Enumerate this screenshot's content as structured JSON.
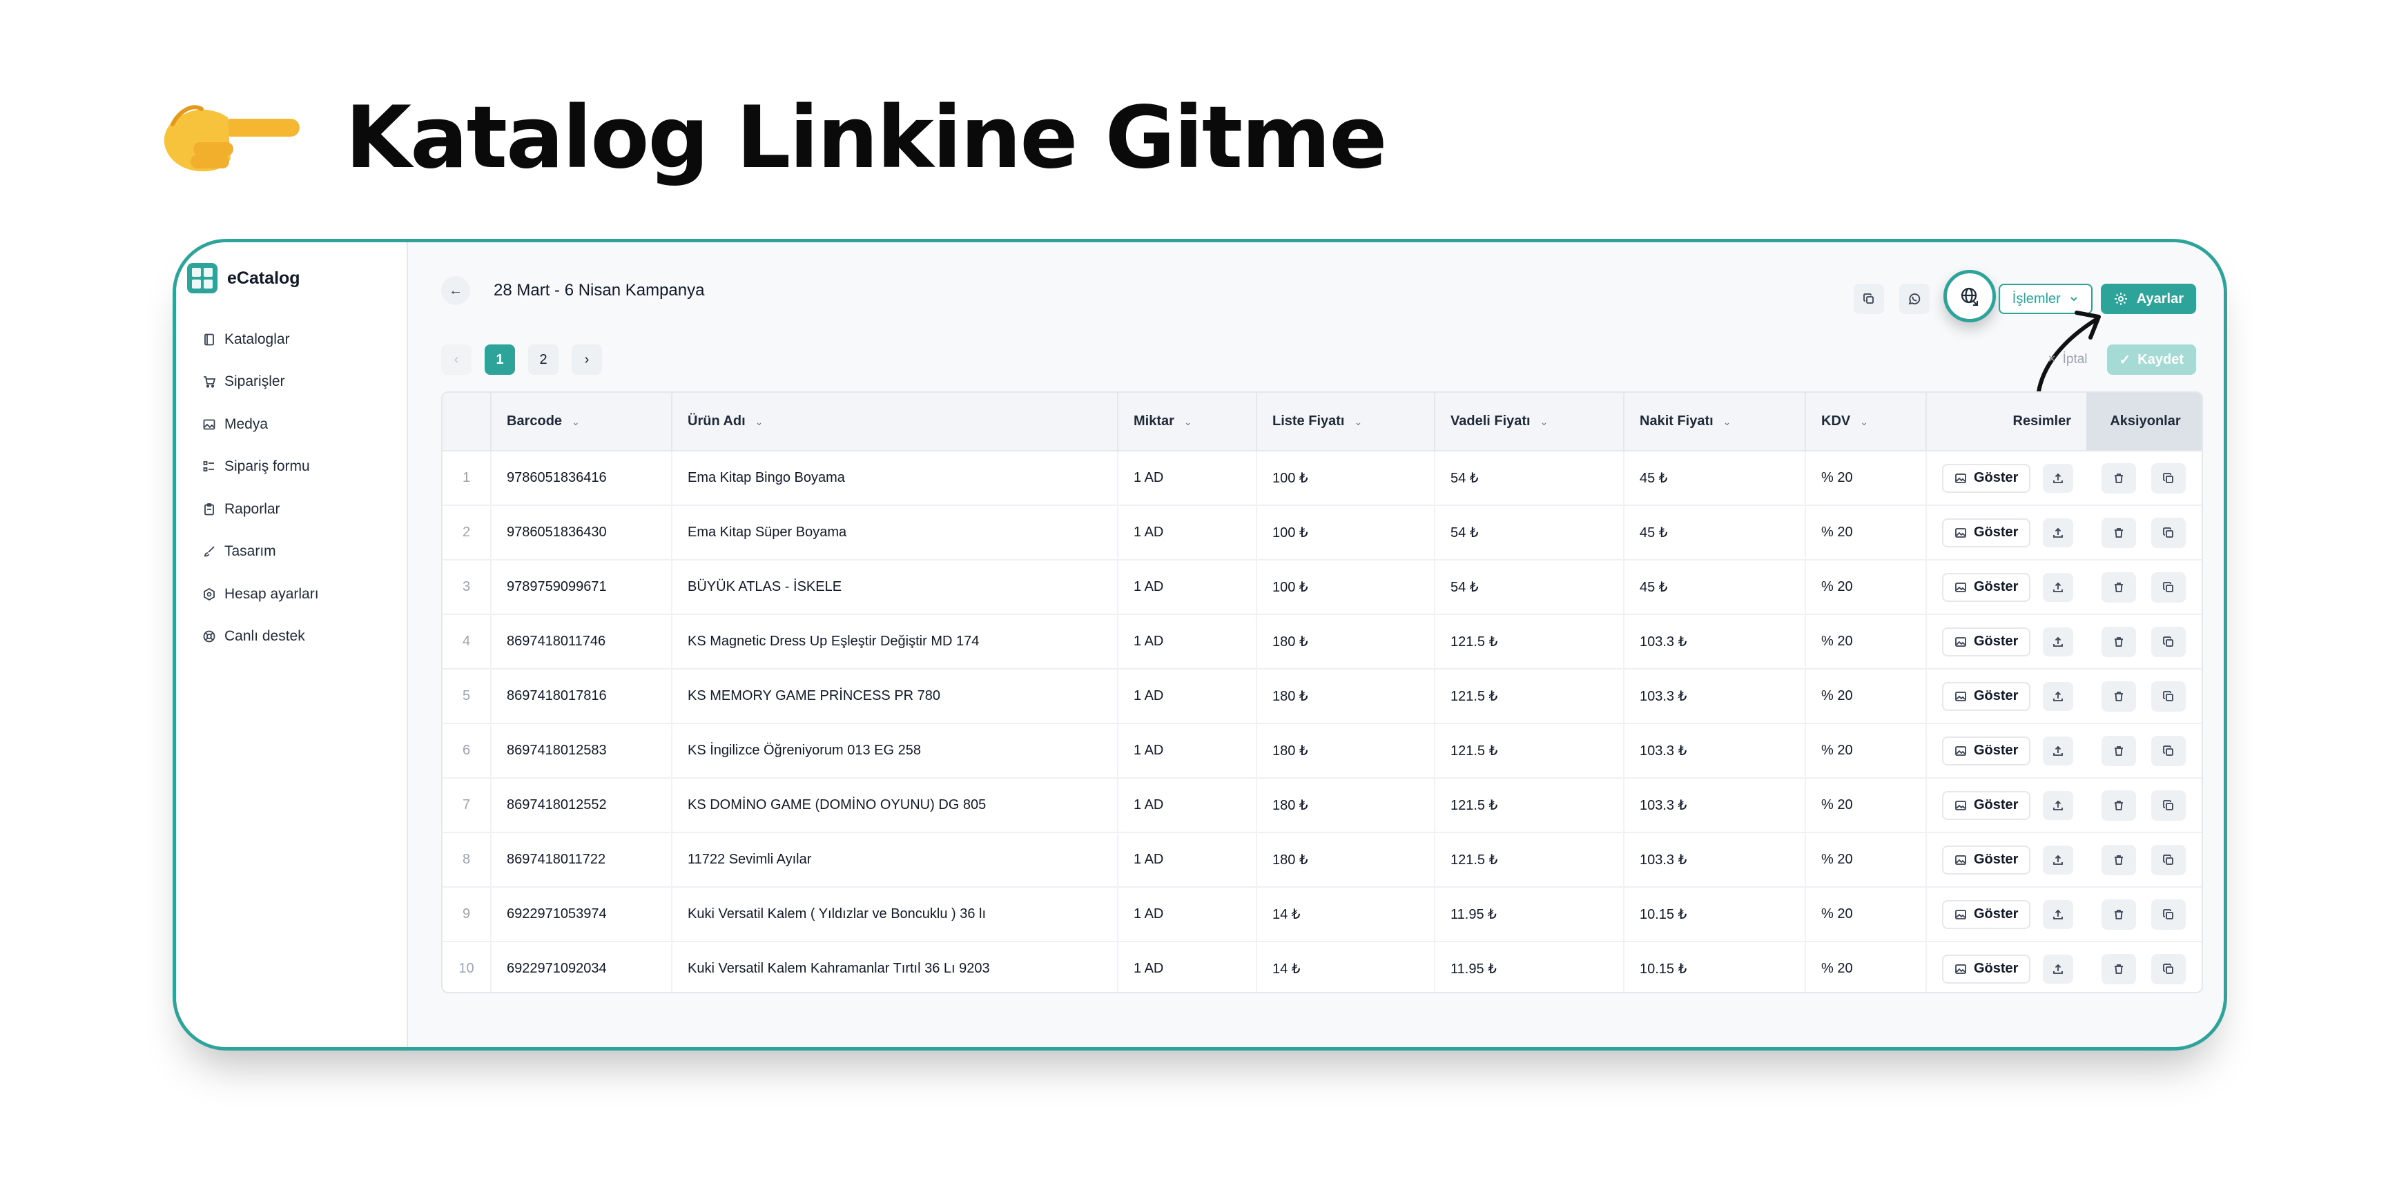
{
  "hero": {
    "title": "Katalog Linkine Gitme"
  },
  "brand": {
    "name": "eCatalog"
  },
  "nav": [
    {
      "label": "Kataloglar",
      "icon": "book-icon"
    },
    {
      "label": "Siparişler",
      "icon": "cart-icon"
    },
    {
      "label": "Medya",
      "icon": "image-icon"
    },
    {
      "label": "Sipariş formu",
      "icon": "form-icon"
    },
    {
      "label": "Raporlar",
      "icon": "clipboard-icon"
    },
    {
      "label": "Tasarım",
      "icon": "brush-icon"
    },
    {
      "label": "Hesap ayarları",
      "icon": "hexagon-settings-icon"
    },
    {
      "label": "Canlı destek",
      "icon": "lifebuoy-icon"
    }
  ],
  "header": {
    "title": "28 Mart - 6 Nisan Kampanya",
    "islemler_label": "İşlemler",
    "ayarlar_label": "Ayarlar"
  },
  "pagination": {
    "pages": [
      "1",
      "2"
    ],
    "current": "1"
  },
  "actions": {
    "iptal_label": "İptal",
    "kaydet_label": "Kaydet"
  },
  "table": {
    "columns": {
      "barcode": "Barcode",
      "urun_adi": "Ürün Adı",
      "miktar": "Miktar",
      "liste_fiyati": "Liste Fiyatı",
      "vadeli_fiyati": "Vadeli Fiyatı",
      "nakit_fiyati": "Nakit Fiyatı",
      "kdv": "KDV",
      "resimler": "Resimler",
      "aksiyonlar": "Aksiyonlar"
    },
    "show_label": "Göster",
    "rows": [
      {
        "no": "1",
        "barcode": "9786051836416",
        "name": "Ema Kitap Bingo Boyama",
        "qty": "1 AD",
        "list": "100 ₺",
        "term": "54 ₺",
        "cash": "45 ₺",
        "kdv": "% 20"
      },
      {
        "no": "2",
        "barcode": "9786051836430",
        "name": "Ema Kitap Süper Boyama",
        "qty": "1 AD",
        "list": "100 ₺",
        "term": "54 ₺",
        "cash": "45 ₺",
        "kdv": "% 20"
      },
      {
        "no": "3",
        "barcode": "9789759099671",
        "name": "BÜYÜK ATLAS - İSKELE",
        "qty": "1 AD",
        "list": "100 ₺",
        "term": "54 ₺",
        "cash": "45 ₺",
        "kdv": "% 20"
      },
      {
        "no": "4",
        "barcode": "8697418011746",
        "name": "KS Magnetic Dress Up Eşleştir Değiştir MD 174",
        "qty": "1 AD",
        "list": "180 ₺",
        "term": "121.5 ₺",
        "cash": "103.3 ₺",
        "kdv": "% 20"
      },
      {
        "no": "5",
        "barcode": "8697418017816",
        "name": "KS MEMORY GAME PRİNCESS PR 780",
        "qty": "1 AD",
        "list": "180 ₺",
        "term": "121.5 ₺",
        "cash": "103.3 ₺",
        "kdv": "% 20"
      },
      {
        "no": "6",
        "barcode": "8697418012583",
        "name": "KS İngilizce Öğreniyorum 013 EG 258",
        "qty": "1 AD",
        "list": "180 ₺",
        "term": "121.5 ₺",
        "cash": "103.3 ₺",
        "kdv": "% 20"
      },
      {
        "no": "7",
        "barcode": "8697418012552",
        "name": "KS DOMİNO GAME (DOMİNO OYUNU) DG 805",
        "qty": "1 AD",
        "list": "180 ₺",
        "term": "121.5 ₺",
        "cash": "103.3 ₺",
        "kdv": "% 20"
      },
      {
        "no": "8",
        "barcode": "8697418011722",
        "name": "11722 Sevimli Ayılar",
        "qty": "1 AD",
        "list": "180 ₺",
        "term": "121.5 ₺",
        "cash": "103.3 ₺",
        "kdv": "% 20"
      },
      {
        "no": "9",
        "barcode": "6922971053974",
        "name": "Kuki Versatil Kalem ( Yıldızlar ve Boncuklu ) 36 lı",
        "qty": "1 AD",
        "list": "14 ₺",
        "term": "11.95 ₺",
        "cash": "10.15 ₺",
        "kdv": "% 20"
      },
      {
        "no": "10",
        "barcode": "6922971092034",
        "name": "Kuki Versatil Kalem Kahramanlar Tırtıl 36 Lı 9203",
        "qty": "1 AD",
        "list": "14 ₺",
        "term": "11.95 ₺",
        "cash": "10.15 ₺",
        "kdv": "% 20"
      }
    ]
  },
  "colors": {
    "accent": "#2ea39a",
    "accent_light": "#a5dad5",
    "frame_border": "#2ea39a"
  }
}
